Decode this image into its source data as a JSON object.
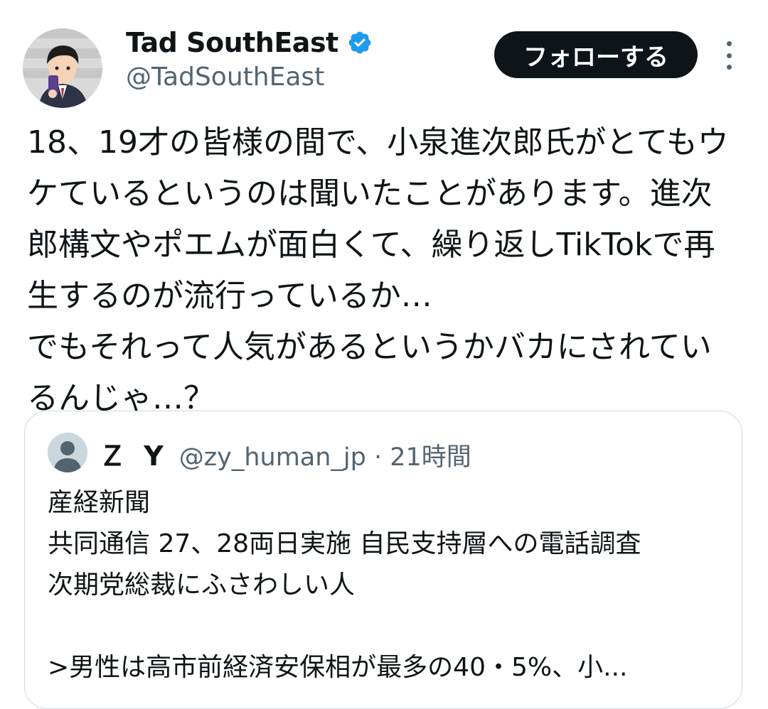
{
  "author": {
    "display_name": "Tad SouthEast",
    "handle": "@TadSouthEast",
    "verified": true,
    "avatar_icon": "profile-photo-avatar"
  },
  "follow_button": {
    "label": "フォローする"
  },
  "more_icon": "vertical-dots-icon",
  "tweet": {
    "text": "18、19才の皆様の間で、小泉進次郎氏がとてもウケているというのは聞いたことがあります。進次郎構文やポエムが面白くて、繰り返しTikTokで再生するのが流行っているか…\nでもそれって人気があるというかバカにされているんじゃ…？"
  },
  "quote": {
    "display_name": "Ｚ Y",
    "handle_time": "@zy_human_jp · 21時間",
    "avatar_icon": "default-user-avatar",
    "text": "産経新聞\n共同通信 27、28両日実施 自民支持層への電話調査\n次期党総裁にふさわしい人\n\n>男性は高市前経済安保相が最多の40・5%、小..."
  },
  "colors": {
    "text": "#0f1419",
    "secondary": "#536471",
    "verified": "#1d9bf0",
    "border": "#cfd9de"
  }
}
